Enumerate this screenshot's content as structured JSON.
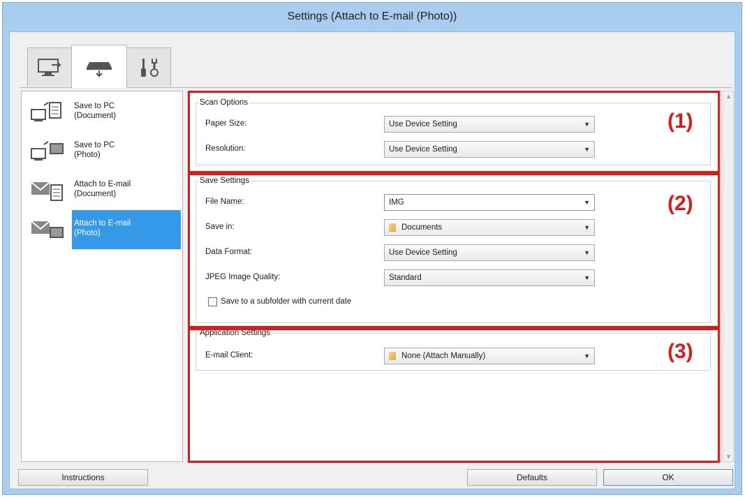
{
  "window": {
    "title": "Settings (Attach to E-mail (Photo))"
  },
  "tabs": [
    {
      "icon": "computer-scan-icon",
      "active": false
    },
    {
      "icon": "scanner-panel-icon",
      "active": true
    },
    {
      "icon": "tools-icon",
      "active": false
    }
  ],
  "nav": {
    "items": [
      {
        "line1": "Save to PC",
        "line2": "(Document)",
        "icon": "save-to-pc-document-icon",
        "selected": false
      },
      {
        "line1": "Save to PC",
        "line2": "(Photo)",
        "icon": "save-to-pc-photo-icon",
        "selected": false
      },
      {
        "line1": "Attach to E-mail",
        "line2": "(Document)",
        "icon": "attach-email-document-icon",
        "selected": false
      },
      {
        "line1": "Attach to E-mail",
        "line2": "(Photo)",
        "icon": "attach-email-photo-icon",
        "selected": true
      }
    ]
  },
  "scan_options": {
    "title": "Scan Options",
    "paper_size_label": "Paper Size:",
    "paper_size_value": "Use Device Setting",
    "resolution_label": "Resolution:",
    "resolution_value": "Use Device Setting"
  },
  "save_settings": {
    "title": "Save Settings",
    "file_name_label": "File Name:",
    "file_name_value": "IMG",
    "save_in_label": "Save in:",
    "save_in_value": "Documents",
    "data_format_label": "Data Format:",
    "data_format_value": "Use Device Setting",
    "jpeg_quality_label": "JPEG Image Quality:",
    "jpeg_quality_value": "Standard",
    "subfolder_label": "Save to a subfolder with current date",
    "subfolder_checked": false
  },
  "application_settings": {
    "title": "Application Settings",
    "email_client_label": "E-mail Client:",
    "email_client_value": "None (Attach Manually)"
  },
  "annotations": {
    "one": "(1)",
    "two": "(2)",
    "three": "(3)",
    "color": "#e01818"
  },
  "buttons": {
    "instructions": "Instructions",
    "defaults": "Defaults",
    "ok": "OK"
  }
}
